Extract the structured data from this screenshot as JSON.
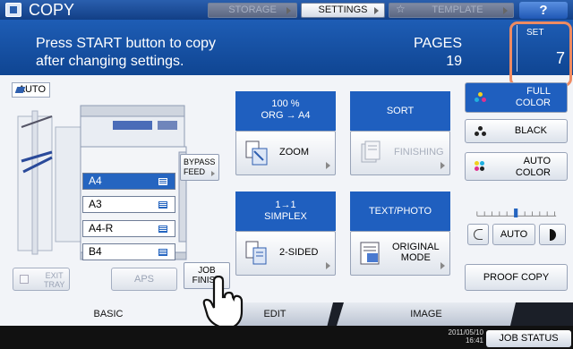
{
  "title": "COPY",
  "top_tabs": {
    "storage": "STORAGE",
    "settings": "SETTINGS",
    "template": "TEMPLATE",
    "help": "?"
  },
  "message": {
    "line1": "Press START button to copy",
    "line2": "after changing settings."
  },
  "pages": {
    "label": "PAGES",
    "value": "19"
  },
  "set": {
    "label": "SET",
    "value": "7"
  },
  "paper": {
    "auto_label": "AUTO",
    "bypass": {
      "line1": "BYPASS",
      "line2": "FEED"
    },
    "trays": [
      {
        "label": "A4",
        "selected": true
      },
      {
        "label": "A3",
        "selected": false
      },
      {
        "label": "A4-R",
        "selected": false
      },
      {
        "label": "B4",
        "selected": false
      }
    ],
    "exit_tray": {
      "line1": "EXIT",
      "line2": "TRAY"
    },
    "aps": "APS",
    "job_finish": {
      "line1": "JOB",
      "line2": "FINISH"
    }
  },
  "zoom": {
    "head_line1": "100 %",
    "head_line2": "ORG  →  A4",
    "label": "ZOOM"
  },
  "sort": {
    "head": "SORT",
    "label": "FINISHING"
  },
  "simplex": {
    "head_line1": "1→1",
    "head_line2": "SIMPLEX",
    "label": "2-SIDED"
  },
  "original": {
    "head": "TEXT/PHOTO",
    "label_line1": "ORIGINAL",
    "label_line2": "MODE"
  },
  "color": {
    "full": {
      "line1": "FULL",
      "line2": "COLOR"
    },
    "black": "BLACK",
    "auto": {
      "line1": "AUTO",
      "line2": "COLOR"
    }
  },
  "density": {
    "auto": "AUTO",
    "level": 0.5
  },
  "proof_copy": "PROOF COPY",
  "bottom_tabs": {
    "basic": "BASIC",
    "edit": "EDIT",
    "image": "IMAGE"
  },
  "datetime": {
    "date": "2011/05/10",
    "time": "16:41"
  },
  "job_status": "JOB STATUS"
}
